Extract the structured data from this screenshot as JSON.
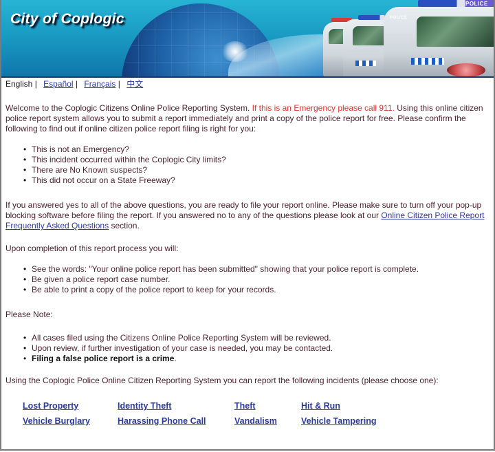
{
  "banner": {
    "title": "City of Coplogic",
    "police_label": "POLICE"
  },
  "languages": {
    "current": "English",
    "separator": "|",
    "links": [
      "Español",
      "Français",
      "中文"
    ]
  },
  "intro": {
    "welcome_text": "Welcome to the Coplogic Citizens Online Police Reporting System.",
    "emergency_text": "If this is an Emergency please call 911.",
    "rest_text": "Using this online citizen police report system allows you to submit a report immediately and print a copy of the police report for free. Please confirm the following to find out if online citizen police report filing is right for you:"
  },
  "checklist": [
    "This is not an Emergency?",
    "This incident occurred within the Coplogic City limits?",
    "There are No Known suspects?",
    "This did not occur on a State Freeway?"
  ],
  "ready": {
    "text": "If you answered yes to all of the above questions, you are ready to file your report online. Please make sure to turn off your pop-up blocking software before filing the report. If you answered no to any of the questions please look at our",
    "faq_link": "Online Citizen Police Report Frequently Asked Questions",
    "suffix": "section."
  },
  "completion": {
    "heading": "Upon completion of this report process you will:",
    "items": [
      "See the words: \"Your online police report has been submitted\" showing that your police report is complete.",
      "Be given a police report case number.",
      "Be able to print a copy of the police report to keep for your records."
    ]
  },
  "note": {
    "heading": "Please Note:",
    "items": [
      "All cases filed using the Citizens Online Police Reporting System will be reviewed.",
      "Upon review, if further investigation of your case is needed, you may be contacted."
    ],
    "bold_item": "Filing a false police report is a crime",
    "bold_item_suffix": "."
  },
  "incidents": {
    "intro": "Using the Coplogic Police Online Citizen Reporting System you can report the following incidents (please choose one):",
    "links": [
      "Lost Property",
      "Identity Theft",
      "Theft",
      "Hit & Run",
      "Vehicle Burglary",
      "Harassing Phone Call",
      "Vandalism",
      "Vehicle Tampering"
    ]
  },
  "colors": {
    "link": "#2c3a9a",
    "emergency": "#e23030",
    "body_text": "#4a1f2e",
    "banner": "#1a9cc4"
  }
}
